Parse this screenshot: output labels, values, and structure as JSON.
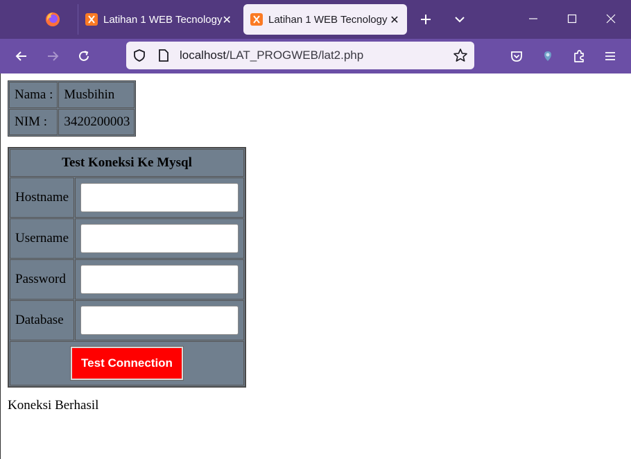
{
  "browser": {
    "tabs": [
      {
        "title": "Latihan 1 WEB Tecnology",
        "active": false
      },
      {
        "title": "Latihan 1 WEB Tecnology",
        "active": true
      }
    ],
    "url_host": "localhost",
    "url_path": "/LAT_PROGWEB/lat2.php",
    "colors": {
      "tabstrip": "#52397f",
      "toolbar": "#6b4fa6",
      "urlbar": "#f3eef8"
    },
    "icons": [
      "firefox-logo-icon",
      "xampp-favicon-icon",
      "close-icon",
      "new-tab-icon",
      "tab-list-icon",
      "minimize-icon",
      "maximize-icon",
      "window-close-icon",
      "back-icon",
      "forward-icon",
      "reload-icon",
      "shield-icon",
      "page-icon",
      "bookmark-star-icon",
      "pocket-icon",
      "vpn-icon",
      "extensions-icon",
      "menu-icon"
    ]
  },
  "info_table": {
    "rows": [
      {
        "label": "Nama :",
        "value": "Musbihin"
      },
      {
        "label": "NIM :",
        "value": "3420200003"
      }
    ]
  },
  "form": {
    "title": "Test Koneksi Ke Mysql",
    "fields": [
      {
        "label": "Hostname",
        "value": ""
      },
      {
        "label": "Username",
        "value": ""
      },
      {
        "label": "Password",
        "value": ""
      },
      {
        "label": "Database",
        "value": ""
      }
    ],
    "button_label": "Test Connection",
    "colors": {
      "table_bg": "#707f8e",
      "button_bg": "#ff0000"
    }
  },
  "status_message": "Koneksi Berhasil"
}
